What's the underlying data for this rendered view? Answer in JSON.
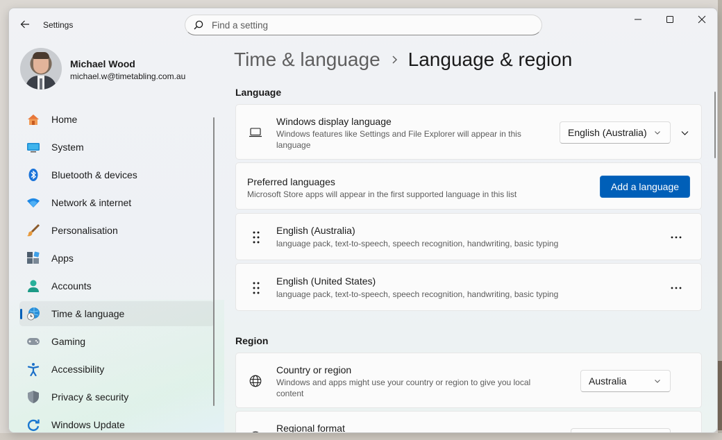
{
  "window": {
    "app_title": "Settings"
  },
  "search": {
    "placeholder": "Find a setting"
  },
  "user": {
    "name": "Michael Wood",
    "email": "michael.w@timetabling.com.au"
  },
  "sidebar": {
    "items": [
      {
        "label": "Home",
        "icon": "home-icon"
      },
      {
        "label": "System",
        "icon": "system-icon"
      },
      {
        "label": "Bluetooth & devices",
        "icon": "bluetooth-icon"
      },
      {
        "label": "Network & internet",
        "icon": "wifi-icon"
      },
      {
        "label": "Personalisation",
        "icon": "brush-icon"
      },
      {
        "label": "Apps",
        "icon": "apps-icon"
      },
      {
        "label": "Accounts",
        "icon": "accounts-icon"
      },
      {
        "label": "Time & language",
        "icon": "time-language-icon",
        "active": true
      },
      {
        "label": "Gaming",
        "icon": "gamepad-icon"
      },
      {
        "label": "Accessibility",
        "icon": "accessibility-icon"
      },
      {
        "label": "Privacy & security",
        "icon": "shield-icon"
      },
      {
        "label": "Windows Update",
        "icon": "update-icon"
      }
    ]
  },
  "breadcrumb": {
    "parent": "Time & language",
    "current": "Language & region"
  },
  "language": {
    "section_title": "Language",
    "display_language": {
      "title": "Windows display language",
      "description": "Windows features like Settings and File Explorer will appear in this language",
      "value": "English (Australia)"
    },
    "preferred": {
      "title": "Preferred languages",
      "description": "Microsoft Store apps will appear in the first supported language in this list",
      "add_button": "Add a language"
    },
    "languages": [
      {
        "name": "English (Australia)",
        "features": "language pack, text-to-speech, speech recognition, handwriting, basic typing"
      },
      {
        "name": "English (United States)",
        "features": "language pack, text-to-speech, speech recognition, handwriting, basic typing"
      }
    ]
  },
  "region": {
    "section_title": "Region",
    "country": {
      "title": "Country or region",
      "description": "Windows and apps might use your country or region to give you local content",
      "value": "Australia"
    },
    "format": {
      "title": "Regional format"
    }
  },
  "colors": {
    "accent": "#005fb8"
  }
}
